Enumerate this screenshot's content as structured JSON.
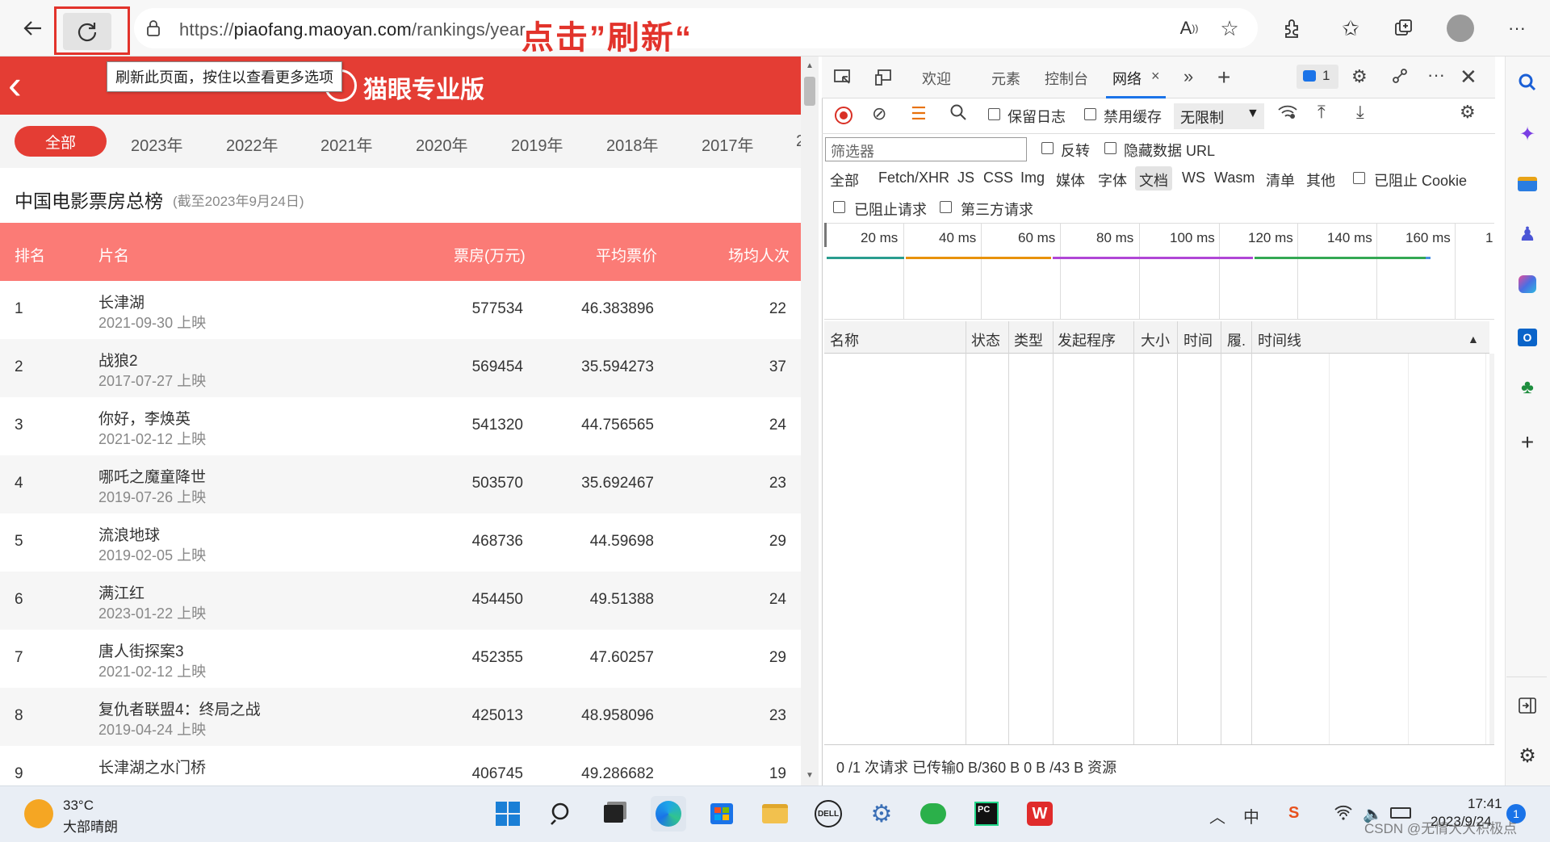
{
  "browser": {
    "url_prefix": "https://",
    "url_domain": "piaofang.maoyan.com",
    "url_path": "/rankings/year",
    "tooltip": "刷新此页面，按住以查看更多选项",
    "annotation": "点击”刷新“"
  },
  "page": {
    "logo_text": "猫眼专业版",
    "years": [
      "全部",
      "2023年",
      "2022年",
      "2021年",
      "2020年",
      "2019年",
      "2018年",
      "2017年",
      "2"
    ],
    "title": "中国电影票房总榜",
    "date_note": "(截至2023年9月24日)",
    "headers": {
      "rank": "排名",
      "name": "片名",
      "box": "票房(万元)",
      "avg_price": "平均票价",
      "avg_people": "场均人次"
    },
    "rows": [
      {
        "rank": "1",
        "name": "长津湖",
        "date": "2021-09-30 上映",
        "box": "577534",
        "price": "46.383896",
        "people": "22"
      },
      {
        "rank": "2",
        "name": "战狼2",
        "date": "2017-07-27 上映",
        "box": "569454",
        "price": "35.594273",
        "people": "37"
      },
      {
        "rank": "3",
        "name": "你好，李焕英",
        "date": "2021-02-12 上映",
        "box": "541320",
        "price": "44.756565",
        "people": "24"
      },
      {
        "rank": "4",
        "name": "哪吒之魔童降世",
        "date": "2019-07-26 上映",
        "box": "503570",
        "price": "35.692467",
        "people": "23"
      },
      {
        "rank": "5",
        "name": "流浪地球",
        "date": "2019-02-05 上映",
        "box": "468736",
        "price": "44.59698",
        "people": "29"
      },
      {
        "rank": "6",
        "name": "满江红",
        "date": "2023-01-22 上映",
        "box": "454450",
        "price": "49.51388",
        "people": "24"
      },
      {
        "rank": "7",
        "name": "唐人街探案3",
        "date": "2021-02-12 上映",
        "box": "452355",
        "price": "47.60257",
        "people": "29"
      },
      {
        "rank": "8",
        "name": "复仇者联盟4：终局之战",
        "date": "2019-04-24 上映",
        "box": "425013",
        "price": "48.958096",
        "people": "23"
      },
      {
        "rank": "9",
        "name": "长津湖之水门桥",
        "date": "",
        "box": "406745",
        "price": "49.286682",
        "people": "19"
      }
    ]
  },
  "devtools": {
    "tabs": {
      "welcome": "欢迎",
      "elements": "元素",
      "console": "控制台",
      "network": "网络"
    },
    "issues_count": "1",
    "preserve_log": "保留日志",
    "disable_cache": "禁用缓存",
    "throttle": "无限制",
    "filter_placeholder": "筛选器",
    "invert": "反转",
    "hide_data_urls": "隐藏数据 URL",
    "types": [
      "全部",
      "Fetch/XHR",
      "JS",
      "CSS",
      "Img",
      "媒体",
      "字体",
      "文档",
      "WS",
      "Wasm",
      "清单",
      "其他"
    ],
    "blocked_cookies": "已阻止 Cookie",
    "blocked_requests": "已阻止请求",
    "third_party": "第三方请求",
    "timeline_labels": [
      "20 ms",
      "40 ms",
      "60 ms",
      "80 ms",
      "100 ms",
      "120 ms",
      "140 ms",
      "160 ms",
      "1"
    ],
    "columns": [
      "名称",
      "状态",
      "类型",
      "发起程序",
      "大小",
      "时间",
      "履.",
      "时间线"
    ],
    "status": "0 /1 次请求  已传输0 B/360 B  0 B /43 B 资源"
  },
  "taskbar": {
    "temp": "33°C",
    "weather": "大部晴朗",
    "time": "17:41",
    "date": "2023/9/24",
    "notifications": "1",
    "ime": "中",
    "watermark": "CSDN @无情大大积极点"
  }
}
